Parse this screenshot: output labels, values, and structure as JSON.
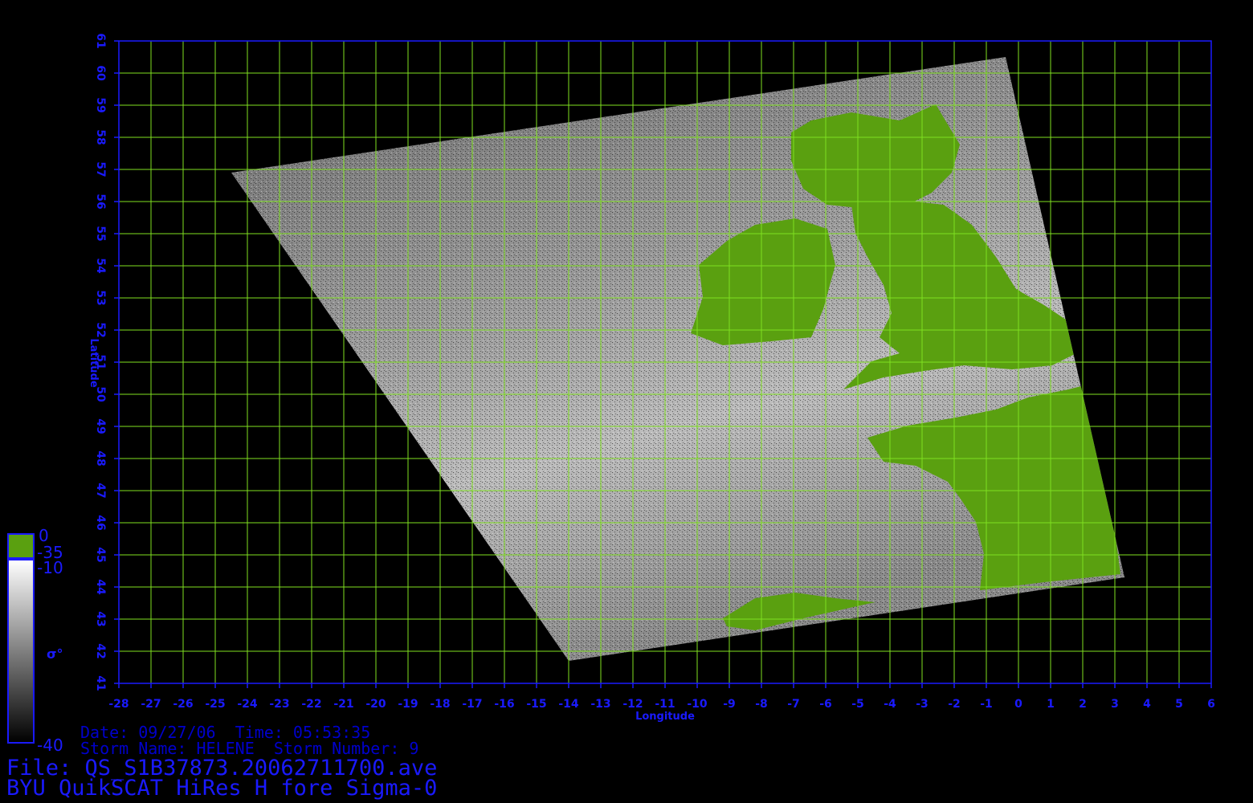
{
  "map": {
    "axes": {
      "xlabel": "Longitude",
      "ylabel": "Latitude",
      "lon_range": [
        -28,
        6
      ],
      "lat_range": [
        41,
        61
      ],
      "lon_ticks": [
        "-28",
        "-27",
        "-26",
        "-25",
        "-24",
        "-23",
        "-22",
        "-21",
        "-20",
        "-19",
        "-18",
        "-17",
        "-16",
        "-15",
        "-14",
        "-13",
        "-12",
        "-11",
        "-10",
        "-9",
        "-8",
        "-7",
        "-6",
        "-5",
        "-4",
        "-3",
        "-2",
        "-1",
        "0",
        "1",
        "2",
        "3",
        "4",
        "5",
        "6"
      ],
      "lat_ticks": [
        "41",
        "42",
        "43",
        "44",
        "45",
        "46",
        "47",
        "48",
        "49",
        "50",
        "51",
        "52",
        "53",
        "54",
        "55",
        "56",
        "57",
        "58",
        "59",
        "60",
        "61"
      ],
      "grid": true
    },
    "colors": {
      "axis": "#1a1aff",
      "grid": "#7fe020",
      "land": "#5aa010",
      "background": "#000000"
    },
    "swath_corners_lonlat": [
      [
        -24.5,
        56.9
      ],
      [
        -0.4,
        60.5
      ],
      [
        3.3,
        44.3
      ],
      [
        -14.0,
        41.7
      ]
    ]
  },
  "colorbar": {
    "symbol": "σ°",
    "labels": {
      "top": "0",
      "land": "-35",
      "upper": "-10",
      "bottom": "-40"
    }
  },
  "info": {
    "date_line": "Date: 09/27/06  Time: 05:53:35",
    "storm_line": "Storm Name: HELENE  Storm Number: 9",
    "file_line": "File: QS_S1B37873.20062711700.ave",
    "product_line": "BYU QuikSCAT HiRes H fore Sigma-0"
  }
}
